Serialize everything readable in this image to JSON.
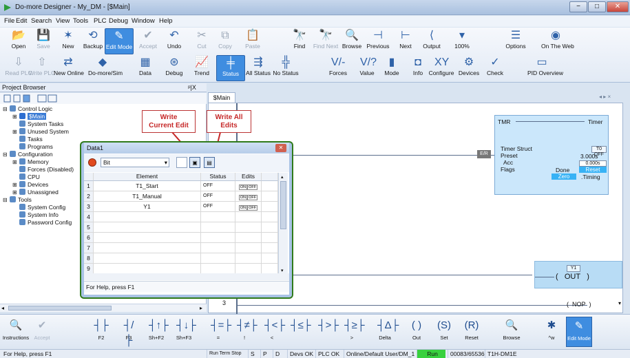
{
  "window": {
    "title": "Do-more Designer - My_DM - [$Main]",
    "minimize": "−",
    "maximize": "□",
    "close": "✕"
  },
  "menu": [
    "File",
    "Edit",
    "Search",
    "View",
    "Tools",
    "PLC",
    "Debug",
    "Window",
    "Help"
  ],
  "toolbar1": {
    "row1": [
      {
        "label": "Open",
        "icon": "folder-open-icon",
        "glyph": "📂",
        "disabled": false
      },
      {
        "label": "Save",
        "icon": "save-icon",
        "glyph": "💾",
        "disabled": true
      },
      {
        "label": "New",
        "icon": "new-project-icon",
        "glyph": "✶",
        "disabled": false
      },
      {
        "label": "Backup",
        "icon": "backup-icon",
        "glyph": "⟲",
        "disabled": false
      },
      {
        "label": "Edit Mode",
        "icon": "edit-mode-icon",
        "glyph": "✎",
        "disabled": false,
        "active": true
      },
      {
        "label": "Accept",
        "icon": "accept-icon",
        "glyph": "✔",
        "disabled": true
      },
      {
        "label": "Undo",
        "icon": "undo-icon",
        "glyph": "↶",
        "disabled": false
      },
      {
        "label": "Cut",
        "icon": "cut-icon",
        "glyph": "✂",
        "disabled": true
      },
      {
        "label": "Copy",
        "icon": "copy-icon",
        "glyph": "⧉",
        "disabled": true
      },
      {
        "label": "Paste",
        "icon": "paste-icon",
        "glyph": "📋",
        "disabled": true
      },
      {
        "label": "Find",
        "icon": "find-icon",
        "glyph": "🔭",
        "disabled": false
      },
      {
        "label": "Find Next",
        "icon": "find-next-icon",
        "glyph": "🔭",
        "disabled": true
      },
      {
        "label": "Browse",
        "icon": "browse-icon",
        "glyph": "🔍",
        "disabled": false
      },
      {
        "label": "Previous",
        "icon": "previous-icon",
        "glyph": "⊣",
        "disabled": false
      },
      {
        "label": "Next",
        "icon": "next-icon",
        "glyph": "⊢",
        "disabled": false
      },
      {
        "label": "Output",
        "icon": "output-icon",
        "glyph": "⟨",
        "disabled": false
      },
      {
        "label": "100%",
        "icon": "zoom-icon",
        "glyph": "▾",
        "disabled": false
      },
      {
        "label": "Options",
        "icon": "options-icon",
        "glyph": "☰",
        "disabled": false
      },
      {
        "label": "On The Web",
        "icon": "web-icon",
        "glyph": "◉",
        "disabled": false
      }
    ],
    "row2": [
      {
        "label": "Read PLC",
        "icon": "read-plc-icon",
        "glyph": "⇩",
        "disabled": true
      },
      {
        "label": "Write PLC",
        "icon": "write-plc-icon",
        "glyph": "⇧",
        "disabled": true
      },
      {
        "label": "New Online",
        "icon": "new-online-icon",
        "glyph": "⇄",
        "disabled": false
      },
      {
        "label": "Do-more/Sim",
        "icon": "sim-icon",
        "glyph": "◆",
        "disabled": false
      },
      {
        "label": "Data",
        "icon": "data-icon",
        "glyph": "▦",
        "disabled": false
      },
      {
        "label": "Debug",
        "icon": "debug-icon",
        "glyph": "⊛",
        "disabled": false
      },
      {
        "label": "Trend",
        "icon": "trend-icon",
        "glyph": "📈",
        "disabled": false
      },
      {
        "label": "Status",
        "icon": "status-icon",
        "glyph": "╪",
        "disabled": false,
        "active": true
      },
      {
        "label": "All Status",
        "icon": "all-status-icon",
        "glyph": "⇶",
        "disabled": false
      },
      {
        "label": "No Status",
        "icon": "no-status-icon",
        "glyph": "╬",
        "disabled": false
      },
      {
        "label": "Forces",
        "icon": "forces-icon",
        "glyph": "V/-",
        "disabled": false
      },
      {
        "label": "Value",
        "icon": "value-icon",
        "glyph": "V/?",
        "disabled": false
      },
      {
        "label": "Mode",
        "icon": "mode-icon",
        "glyph": "▮",
        "disabled": false
      },
      {
        "label": "Info",
        "icon": "info-icon",
        "glyph": "◘",
        "disabled": false
      },
      {
        "label": "Configure",
        "icon": "configure-icon",
        "glyph": "XY",
        "disabled": false
      },
      {
        "label": "Devices",
        "icon": "devices-icon",
        "glyph": "⚙",
        "disabled": false
      },
      {
        "label": "Check",
        "icon": "check-icon",
        "glyph": "✓",
        "disabled": false
      },
      {
        "label": "PID Overview",
        "icon": "pid-overview-icon",
        "glyph": "▭",
        "disabled": false
      }
    ]
  },
  "project_browser": {
    "title": "Project Browser",
    "pin": "ᵖ|X",
    "tree": [
      {
        "label": "Control Logic",
        "indent": 0,
        "icon": "logic-icon",
        "expand": "⊟"
      },
      {
        "label": "$Main",
        "indent": 1,
        "icon": "main-program-icon",
        "expand": "⊞",
        "selected": true
      },
      {
        "label": "System Tasks",
        "indent": 1,
        "icon": "tasks-icon",
        "expand": ""
      },
      {
        "label": "Unused System",
        "indent": 1,
        "icon": "unused-icon",
        "expand": "⊞"
      },
      {
        "label": "Tasks",
        "indent": 1,
        "icon": "tasks-icon",
        "expand": ""
      },
      {
        "label": "Programs",
        "indent": 1,
        "icon": "programs-icon",
        "expand": ""
      },
      {
        "label": "Configuration",
        "indent": 0,
        "icon": "config-icon",
        "expand": "⊟"
      },
      {
        "label": "Memory",
        "indent": 1,
        "icon": "memory-icon",
        "expand": "⊞"
      },
      {
        "label": "Forces (Disabled)",
        "indent": 1,
        "icon": "forces-icon",
        "expand": ""
      },
      {
        "label": "CPU",
        "indent": 1,
        "icon": "cpu-icon",
        "expand": ""
      },
      {
        "label": "Devices",
        "indent": 1,
        "icon": "devices-icon",
        "expand": "⊞"
      },
      {
        "label": "Unassigned",
        "indent": 1,
        "icon": "unassigned-icon",
        "expand": "⊞"
      },
      {
        "label": "Tools",
        "indent": 0,
        "icon": "tools-icon",
        "expand": "⊟"
      },
      {
        "label": "System Config",
        "indent": 1,
        "icon": "xy-icon",
        "expand": ""
      },
      {
        "label": "System Info",
        "indent": 1,
        "icon": "info-icon",
        "expand": ""
      },
      {
        "label": "Password Config",
        "indent": 1,
        "icon": "password-icon",
        "expand": ""
      }
    ]
  },
  "editor": {
    "tab": "$Main",
    "tab_nav": "◂ ▸ ×",
    "rung_number": "3",
    "er_label": "E/R",
    "timer": {
      "name": "TMR",
      "type": "Timer",
      "struct_label": "Timer Struct",
      "preset_label": "Preset",
      "acc_label": "Acc",
      "flags_label": "Flags",
      "done_label": "Done",
      "timing_label": ".Timing",
      "preset_value": "3.000s",
      "acc_value": "0.000s",
      "reset_label": "Reset",
      "zero_label": "Zero",
      "struct_value": "T0 OFF"
    },
    "out_label": "OUT",
    "out_addr": "Y1",
    "nop_label": "NOP"
  },
  "callouts": {
    "write_current": "Write\nCurrent Edit",
    "write_all": "Write All\nEdits"
  },
  "data_window": {
    "title": "Data1",
    "format": "Bit",
    "help": "For Help, press F1",
    "columns": [
      "Element",
      "Status",
      "Edits"
    ],
    "rows": [
      {
        "n": "1",
        "element": "T1_Start",
        "status": "OFF",
        "edit": true
      },
      {
        "n": "2",
        "element": "T1_Manual",
        "status": "OFF",
        "edit": true
      },
      {
        "n": "3",
        "element": "Y1",
        "status": "OFF",
        "edit": true
      },
      {
        "n": "4",
        "element": "",
        "status": "",
        "edit": false
      },
      {
        "n": "5",
        "element": "",
        "status": "",
        "edit": false
      },
      {
        "n": "6",
        "element": "",
        "status": "",
        "edit": false
      },
      {
        "n": "7",
        "element": "",
        "status": "",
        "edit": false
      },
      {
        "n": "8",
        "element": "",
        "status": "",
        "edit": false
      },
      {
        "n": "9",
        "element": "",
        "status": "",
        "edit": false
      }
    ],
    "on": "ON",
    "off": "OFF"
  },
  "bottom_toolbar": [
    {
      "label": "Instructions",
      "glyph": "🔍",
      "icon": "instructions-icon",
      "disabled": false
    },
    {
      "label": "Accept",
      "glyph": "✔",
      "icon": "accept-icon",
      "disabled": true
    },
    {
      "label": "F2",
      "glyph": "┤├",
      "icon": "contact-no-icon"
    },
    {
      "label": "F3",
      "glyph": "┤/├",
      "icon": "contact-nc-icon"
    },
    {
      "label": "Sh+F2",
      "glyph": "┤↑├",
      "icon": "edge-up-icon"
    },
    {
      "label": "Sh+F3",
      "glyph": "┤↓├",
      "icon": "edge-down-icon"
    },
    {
      "label": "=",
      "glyph": "┤=├",
      "icon": "compare-eq-icon"
    },
    {
      "label": "!",
      "glyph": "┤≠├",
      "icon": "compare-ne-icon"
    },
    {
      "label": "<",
      "glyph": "┤<├",
      "icon": "compare-lt-icon"
    },
    {
      "label": "",
      "glyph": "┤≤├",
      "icon": "compare-le-icon"
    },
    {
      "label": "",
      "glyph": "┤>├",
      "icon": "compare-gt-icon"
    },
    {
      "label": ">",
      "glyph": "┤≥├",
      "icon": "compare-ge-icon"
    },
    {
      "label": "Delta",
      "glyph": "┤Δ├",
      "icon": "delta-icon"
    },
    {
      "label": "Out",
      "glyph": "( )",
      "icon": "coil-out-icon"
    },
    {
      "label": "Set",
      "glyph": "(S)",
      "icon": "coil-set-icon"
    },
    {
      "label": "Reset",
      "glyph": "(R)",
      "icon": "coil-reset-icon"
    },
    {
      "label": "Browse",
      "glyph": "🔍",
      "icon": "browse-icon"
    },
    {
      "label": "^w",
      "glyph": "✱",
      "icon": "wire-icon"
    },
    {
      "label": "Edit Mode",
      "glyph": "✎",
      "icon": "edit-mode-icon",
      "active": true
    }
  ],
  "status_bar": {
    "help": "For Help, press F1",
    "run_mode": "Run Term Stop",
    "s": "S",
    "p": "P",
    "d": "D",
    "devs": "Devs OK",
    "plc": "PLC OK",
    "user": "Online/Default User/DM_1",
    "run": "Run",
    "memory": "00083/65536",
    "cpu": "T1H-DM1E"
  },
  "colors": {
    "accent": "#3f8de0",
    "callout_red": "#c62828",
    "run_green": "#39d13e",
    "timer_bg": "#cbe7fb"
  }
}
